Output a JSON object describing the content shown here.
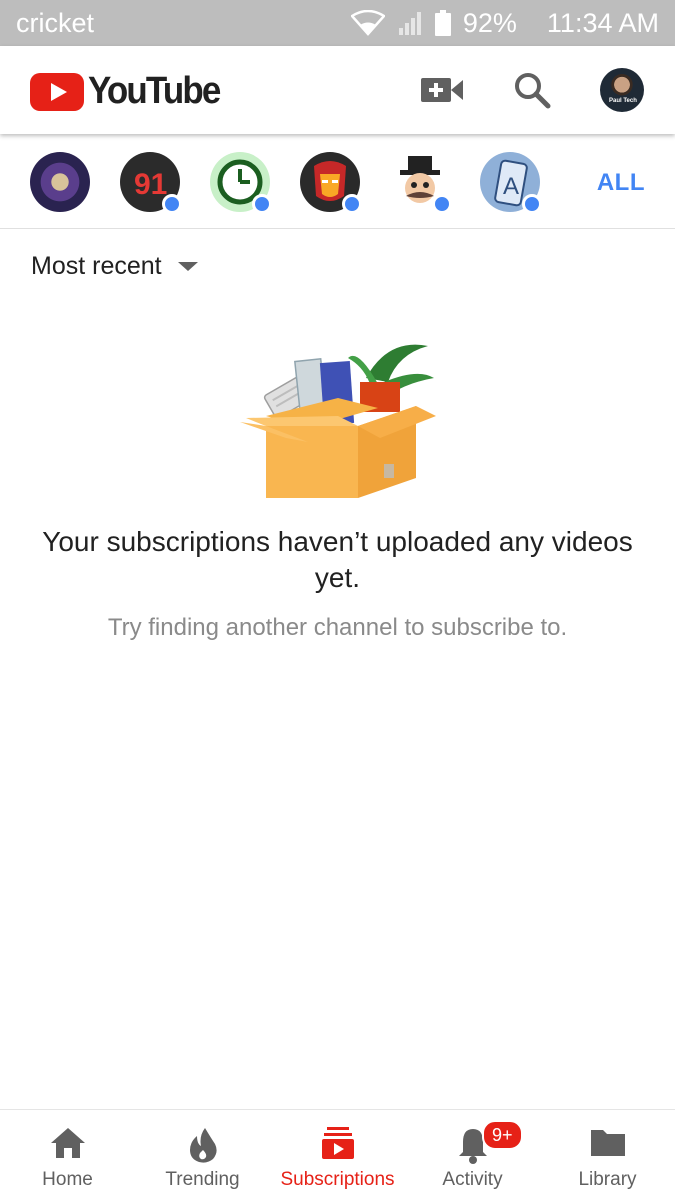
{
  "status_bar": {
    "carrier": "cricket",
    "battery": "92%",
    "time": "11:34 AM",
    "icons": [
      "wifi-icon",
      "signal-icon",
      "battery-icon"
    ]
  },
  "header": {
    "logo_text": "YouTube",
    "icons": [
      "upload-video-icon",
      "search-icon"
    ],
    "avatar_caption": "Paul Tech"
  },
  "channels": {
    "items": [
      {
        "name": "channel-1",
        "has_new": false
      },
      {
        "name": "channel-2",
        "has_new": true
      },
      {
        "name": "channel-3",
        "has_new": true
      },
      {
        "name": "channel-4",
        "has_new": true
      },
      {
        "name": "channel-5",
        "has_new": true
      },
      {
        "name": "channel-6",
        "has_new": true
      }
    ],
    "all_label": "ALL"
  },
  "sort": {
    "label": "Most recent"
  },
  "empty_state": {
    "title": "Your subscriptions haven’t uploaded any videos yet.",
    "subtitle": "Try finding another channel to subscribe to."
  },
  "bottom_nav": {
    "items": [
      {
        "label": "Home",
        "icon": "home-icon",
        "active": false
      },
      {
        "label": "Trending",
        "icon": "trending-flame-icon",
        "active": false
      },
      {
        "label": "Subscriptions",
        "icon": "subscriptions-icon",
        "active": true
      },
      {
        "label": "Activity",
        "icon": "bell-icon",
        "active": false,
        "badge": "9+"
      },
      {
        "label": "Library",
        "icon": "folder-icon",
        "active": false
      }
    ]
  },
  "colors": {
    "brand_red": "#e62117",
    "accent_blue": "#4285f4",
    "status_bar": "#bdbdbd"
  }
}
